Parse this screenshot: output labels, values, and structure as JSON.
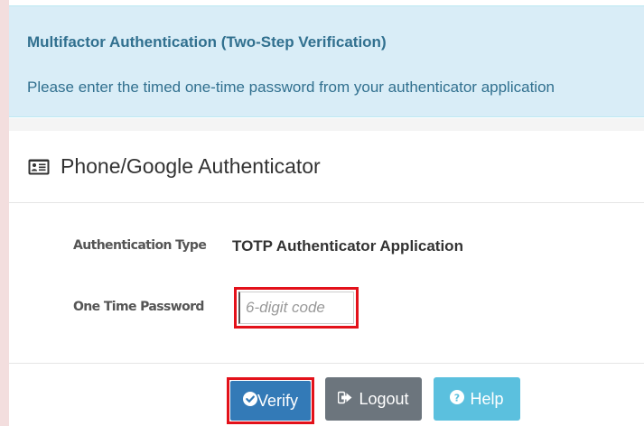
{
  "alert": {
    "title": "Multifactor Authentication (Two-Step Verification)",
    "message": "Please enter the timed one-time password from your authenticator application"
  },
  "panel": {
    "icon": "id-card-icon",
    "title": "Phone/Google Authenticator"
  },
  "form": {
    "auth_type_label": "Authentication Type",
    "auth_type_value": "TOTP Authenticator Application",
    "otp_label": "One Time Password",
    "otp_placeholder": "6-digit code",
    "otp_value": ""
  },
  "buttons": {
    "verify": {
      "label": "Verify",
      "icon": "check-circle-icon"
    },
    "logout": {
      "label": "Logout",
      "icon": "sign-out-icon"
    },
    "help": {
      "label": "Help",
      "icon": "question-circle-icon"
    }
  },
  "colors": {
    "alert_bg": "#d9edf7",
    "alert_text": "#31708f",
    "primary": "#337ab7",
    "secondary": "#6c757d",
    "info": "#5bc0de",
    "highlight_border": "#e3111a"
  }
}
